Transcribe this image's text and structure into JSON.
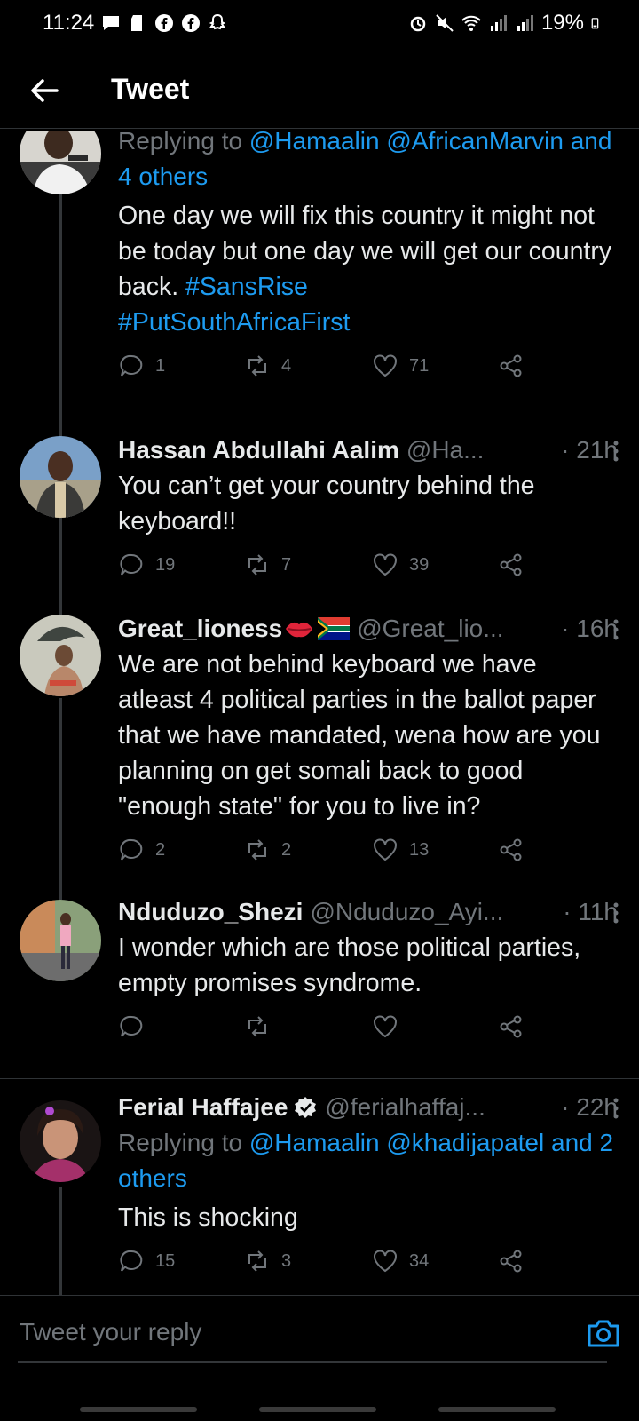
{
  "status_bar": {
    "time": "11:24",
    "battery": "19%"
  },
  "header": {
    "title": "Tweet"
  },
  "tweets": [
    {
      "replying_prefix": "Replying to",
      "mentions": "@Hamaalin @AfricanMarvin",
      "others": "and 4 others",
      "text": "One day we will fix this country it might not be today but one day we will get our country back.",
      "hashtags": [
        "#SansRise",
        "#PutSouthAfricaFirst"
      ],
      "replies": "1",
      "retweets": "4",
      "likes": "71"
    },
    {
      "name": "Hassan Abdullahi Aalim",
      "handle": "@Ha...",
      "time": "· 21h",
      "text": "You can’t get your country behind the keyboard!!",
      "replies": "19",
      "retweets": "7",
      "likes": "39"
    },
    {
      "name": "Great_lioness",
      "handle": "@Great_lio...",
      "time": "· 16h",
      "text": "We are not behind keyboard we have atleast 4 political parties in the ballot paper that we have mandated, wena how are you planning on get somali back to good \"enough state\" for you to live in?",
      "replies": "2",
      "retweets": "2",
      "likes": "13"
    },
    {
      "name": "Nduduzo_Shezi",
      "handle": "@Nduduzo_Ayi...",
      "time": "· 11h",
      "text": "I wonder which are those political parties, empty promises syndrome.",
      "replies": "",
      "retweets": "",
      "likes": ""
    },
    {
      "name": "Ferial Haffajee",
      "handle": "@ferialhaffaj...",
      "time": "· 22h",
      "replying_prefix": "Replying to",
      "mentions": "@Hamaalin @khadijapatel",
      "others": "and 2 others",
      "text": "This is shocking",
      "replies": "15",
      "retweets": "3",
      "likes": "34"
    }
  ],
  "reply_bar": {
    "placeholder": "Tweet your reply"
  },
  "colors": {
    "background": "#000000",
    "link": "#1d9bf0",
    "muted": "#71767b",
    "verified": "#e7e9ea"
  }
}
